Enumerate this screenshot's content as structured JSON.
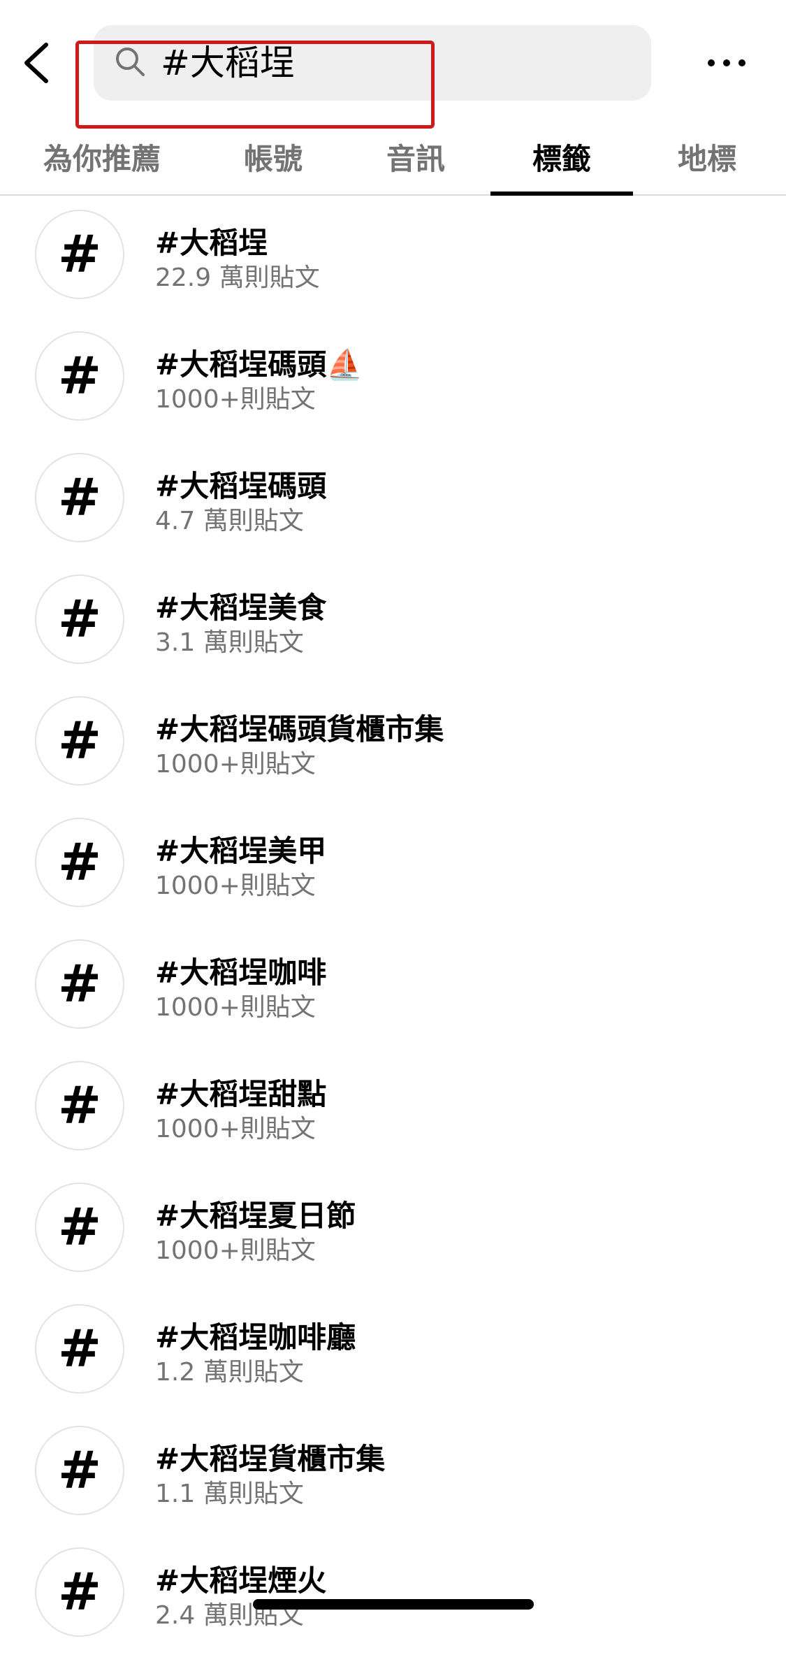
{
  "header": {
    "back_icon": "chevron-left-icon",
    "search": {
      "icon": "search-icon",
      "value": "#大稻埕"
    },
    "more_icon": "more-horizontal-icon",
    "highlight_color": "#cc1b1b"
  },
  "tabs": [
    {
      "label": "為你推薦",
      "active": false
    },
    {
      "label": "帳號",
      "active": false
    },
    {
      "label": "音訊",
      "active": false
    },
    {
      "label": "標籤",
      "active": true
    },
    {
      "label": "地標",
      "active": false
    }
  ],
  "results": [
    {
      "icon": "#",
      "title": "#大稻埕",
      "subtitle": "22.9 萬則貼文"
    },
    {
      "icon": "#",
      "title": "#大稻埕碼頭⛵",
      "subtitle": "1000+則貼文"
    },
    {
      "icon": "#",
      "title": "#大稻埕碼頭",
      "subtitle": "4.7 萬則貼文"
    },
    {
      "icon": "#",
      "title": "#大稻埕美食",
      "subtitle": "3.1 萬則貼文"
    },
    {
      "icon": "#",
      "title": "#大稻埕碼頭貨櫃市集",
      "subtitle": "1000+則貼文"
    },
    {
      "icon": "#",
      "title": "#大稻埕美甲",
      "subtitle": "1000+則貼文"
    },
    {
      "icon": "#",
      "title": "#大稻埕咖啡",
      "subtitle": "1000+則貼文"
    },
    {
      "icon": "#",
      "title": "#大稻埕甜點",
      "subtitle": "1000+則貼文"
    },
    {
      "icon": "#",
      "title": "#大稻埕夏日節",
      "subtitle": "1000+則貼文"
    },
    {
      "icon": "#",
      "title": "#大稻埕咖啡廳",
      "subtitle": "1.2 萬則貼文"
    },
    {
      "icon": "#",
      "title": "#大稻埕貨櫃市集",
      "subtitle": "1.1 萬則貼文"
    },
    {
      "icon": "#",
      "title": "#大稻埕煙火",
      "subtitle": "2.4 萬則貼文"
    }
  ]
}
